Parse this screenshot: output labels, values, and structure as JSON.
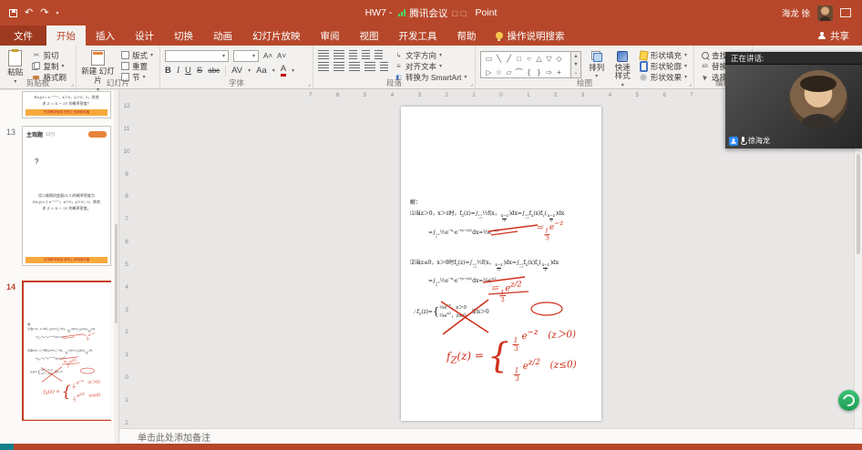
{
  "titlebar": {
    "title_prefix": "HW7 -",
    "title_suffix": "Point",
    "meeting_badge": "腾讯会议",
    "user_name": "海龙 徐"
  },
  "tabs": {
    "file": "文件",
    "items": [
      "开始",
      "插入",
      "设计",
      "切换",
      "动画",
      "幻灯片放映",
      "审阅",
      "视图",
      "开发工具",
      "帮助"
    ],
    "selected": "开始",
    "tellme": "操作说明搜索",
    "share": "共享"
  },
  "ribbon": {
    "clipboard": {
      "label": "剪贴板",
      "paste": "粘贴",
      "items": [
        {
          "label": "剪切",
          "cls": "ic-cut",
          "dd": ""
        },
        {
          "label": "复制",
          "cls": "ic-copy",
          "dd": "▾"
        },
        {
          "label": "格式刷",
          "cls": "ic-painter",
          "dd": ""
        }
      ]
    },
    "slides": {
      "label": "幻灯片",
      "new_slide": "新建 幻灯片",
      "items": [
        {
          "label": "版式",
          "cls": "ic-layout",
          "dd": "▾"
        },
        {
          "label": "重置",
          "cls": "ic-reset",
          "dd": ""
        },
        {
          "label": "节",
          "cls": "ic-section",
          "dd": "▾"
        }
      ]
    },
    "font": {
      "label": "字体",
      "b": "B",
      "i": "I",
      "u": "U",
      "s": "S",
      "abc": "abc",
      "av": "AV",
      "aa": "Aa",
      "colorA": "A",
      "grow": "A˄",
      "shrink": "A˅"
    },
    "paragraph": {
      "label": "段落",
      "stack": [
        {
          "label": "文字方向",
          "cls": "ic-dir",
          "dd": "▾"
        },
        {
          "label": "对齐文本",
          "cls": "ic-aligntext",
          "dd": "▾"
        },
        {
          "label": "转换为 SmartArt",
          "cls": "ic-smartart",
          "dd": "▾"
        }
      ]
    },
    "drawing": {
      "label": "绘图",
      "shapes": [
        "▭",
        "╲",
        "╱",
        "□",
        "○",
        "△",
        "▽",
        "◇",
        "▷",
        "☆",
        "▱",
        "⌒",
        "{",
        "}",
        "⇨",
        "+"
      ],
      "arrange": "排列",
      "quick_styles": "快速样式",
      "stack": [
        {
          "label": "形状填充",
          "cls": "ic-fill",
          "dd": "▾"
        },
        {
          "label": "形状轮廓",
          "cls": "ic-outline",
          "dd": "▾"
        },
        {
          "label": "形状效果",
          "cls": "ic-effects",
          "dd": "▾"
        }
      ]
    },
    "editing": {
      "label": "编辑",
      "items": [
        {
          "label": "查找",
          "cls": "ic-find",
          "dd": ""
        },
        {
          "label": "替换",
          "cls": "ic-replace",
          "dd": "▾"
        },
        {
          "label": "选择",
          "cls": "ic-select",
          "dd": "▾"
        }
      ]
    }
  },
  "meeting": {
    "speaking_label": "正在讲话:",
    "participant": "徐海龙"
  },
  "thumbs": {
    "banner": "仅供教学使用 请勿上传网络传播",
    "slide12": {
      "line1": "f(x,y)= e⁻⁽ˣ⁺ʸ⁾，x＞0，y＞0；0，其他",
      "line2": "求 Z = X − 2Y 的概率密度？"
    },
    "slide13": {
      "num": "13",
      "title": "主观题",
      "score": "10分",
      "q": "?",
      "body1": "设二维随机变量(X,Y)的概率密度为",
      "body2": "f(x,y)={ e⁻⁽ˣ⁺ʸ⁾，x＞0，y＞0；0，其他",
      "body3": "求 Z = X − 2Y 的概率密度。"
    },
    "slide14": {
      "num": "14"
    }
  },
  "rulers": {
    "h": [
      "7",
      "6",
      "5",
      "4",
      "3",
      "2",
      "1",
      "0",
      "1",
      "2",
      "3",
      "4",
      "5",
      "6",
      "7"
    ],
    "v": [
      "12",
      "11",
      "10",
      "9",
      "8",
      "7",
      "6",
      "5",
      "4",
      "3",
      "2",
      "1",
      "0",
      "1",
      "2"
    ]
  },
  "slide": {
    "f1": "解：",
    "f2": "⑴当z＞0，x＞z时，f<sub>Z</sub>(z)=∫<span class='lim'><b>+∞</b><i>−∞</i></span>½f(x，<span class='fr'><b>x−z</b><i>2</i></span>)dx=∫<span class='lim'><b>+∞</b><i>−∞</i></span>f<sub>X</sub>(x)f<sub>Y</sub>(<span class='fr'><b>x−z</b><i>2</i></span>)dx",
    "f3": "=∫<span class='lim'><b>+∞</b><i>z</i></span>½e<sup>−x</sup>·e<sup>−(x−z)/2</sup>dx=⅔e<sup>−z/2</sup>",
    "f4": "⑵当z≤0，x＞0时f<sub>Z</sub>(z)=∫<span class='lim'><b>+∞</b><i>−∞</i></span>½f(x，<span class='fr'><b>x−z</b><i>2</i></span>)dx=∫<span class='lim'><b>+∞</b><i>−∞</i></span>f<sub>X</sub>(x)f<sub>Y</sub>(<span class='fr'><b>x−z</b><i>2</i></span>)dx",
    "f5": "=∫<span class='lim'><b>+∞</b><i>0</i></span>½e<sup>−x</sup>·e<sup>−(x−z)/2</sup>dx=⅔e<sup>z/2</sup>",
    "f6": "∴f<sub>Z</sub>(z)=<span class='brace'>{</span><span class='cases'><span>⅓e<sup>−z</sup>，z＞0</span><span>⅓e<sup>z/2</sup>，z≤0</span></span>　⑵x＞0",
    "red": {
      "r1": "＝<span class='fr'><b>1</b><i>3</i></span>e<sup>−z</sup>",
      "r2": "＝<span class='fr'><b>1</b><i>3</i></span>e<sup>z/2</sup>",
      "fz": "f<sub>Z</sub>(z) =",
      "case1": "<span class='fr'><b>1</b><i>3</i></span> e<sup>−z</sup>　(z＞0)",
      "case2": "<span class='fr'><b>1</b><i>3</i></span> e<sup>z/2</sup>　(z≤0)"
    }
  },
  "notes": {
    "placeholder": "单击此处添加备注"
  }
}
